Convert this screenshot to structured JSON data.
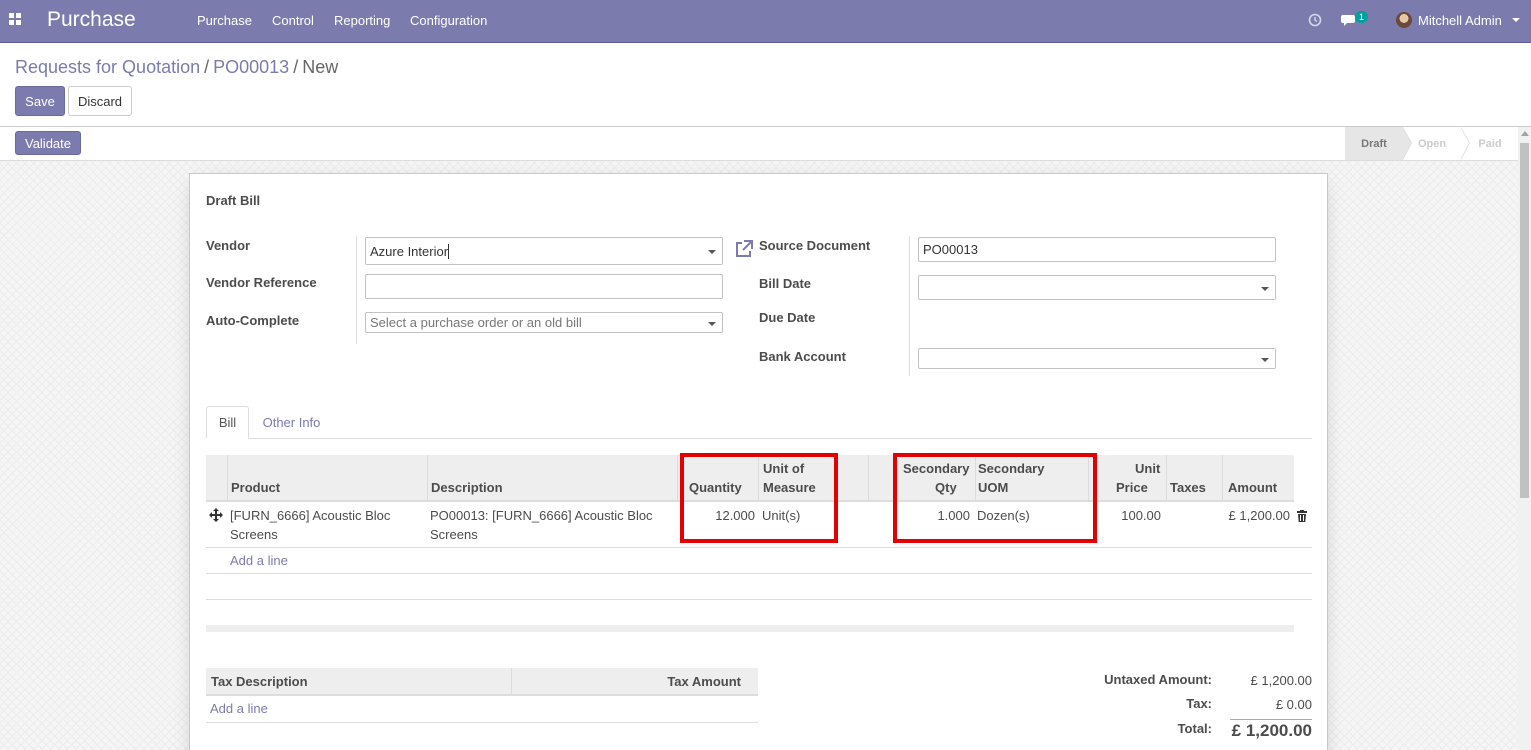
{
  "navbar": {
    "brand": "Purchase",
    "menu": [
      "Purchase",
      "Control",
      "Reporting",
      "Configuration"
    ],
    "message_count": "1",
    "user_name": "Mitchell Admin",
    "color": "#7c7bad"
  },
  "breadcrumb": {
    "items": [
      "Requests for Quotation",
      "PO00013"
    ],
    "current": "New"
  },
  "actions": {
    "save": "Save",
    "discard": "Discard",
    "validate": "Validate"
  },
  "status": {
    "stages": [
      "Draft",
      "Open",
      "Paid"
    ],
    "active": "Draft"
  },
  "form": {
    "title": "Draft Bill",
    "left": {
      "vendor_label": "Vendor",
      "vendor_value": "Azure Interior",
      "vendor_ref_label": "Vendor Reference",
      "vendor_ref_value": "",
      "autocomplete_label": "Auto-Complete",
      "autocomplete_placeholder": "Select a purchase order or an old bill"
    },
    "right": {
      "source_label": "Source Document",
      "source_value": "PO00013",
      "bill_date_label": "Bill Date",
      "bill_date_value": "",
      "due_date_label": "Due Date",
      "bank_label": "Bank Account",
      "bank_value": ""
    }
  },
  "tabs": [
    "Bill",
    "Other Info"
  ],
  "lines": {
    "headers": {
      "product": "Product",
      "description": "Description",
      "quantity": "Quantity",
      "uom_1": "Unit of",
      "uom_2": "Measure",
      "sec_qty_1": "Secondary",
      "sec_qty_2": "Qty",
      "sec_uom_1": "Secondary",
      "sec_uom_2": "UOM",
      "price_1": "Unit",
      "price_2": "Price",
      "taxes": "Taxes",
      "amount": "Amount"
    },
    "rows": [
      {
        "product_1": "[FURN_6666] Acoustic Bloc",
        "product_2": "Screens",
        "description_1": "PO00013: [FURN_6666] Acoustic Bloc",
        "description_2": "Screens",
        "quantity": "12.000",
        "uom": "Unit(s)",
        "sec_qty": "1.000",
        "sec_uom": "Dozen(s)",
        "price": "100.00",
        "taxes": "",
        "amount": "£ 1,200.00"
      }
    ],
    "add_line": "Add a line"
  },
  "tax_table": {
    "description_header": "Tax Description",
    "amount_header": "Tax Amount",
    "add_line": "Add a line"
  },
  "totals": {
    "untaxed_label": "Untaxed Amount:",
    "untaxed_value": "£ 1,200.00",
    "tax_label": "Tax:",
    "tax_value": "£ 0.00",
    "total_label": "Total:",
    "total_value": "£ 1,200.00"
  },
  "highlight_color": "#e30000"
}
